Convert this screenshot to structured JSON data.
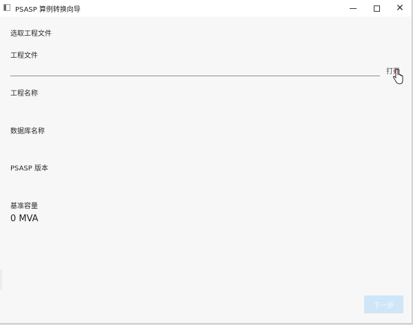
{
  "window": {
    "title": "PSASP 算例转换向导",
    "icon": "app-window-icon"
  },
  "titlebar_buttons": {
    "minimize": "minimize-icon",
    "maximize": "maximize-icon",
    "close_glyph": "✕"
  },
  "form": {
    "section_title": "选取工程文件",
    "project_file_label": "工程文件",
    "project_file_value": "",
    "open_button_label": "打开",
    "project_name_label": "工程名称",
    "database_name_label": "数据库名称",
    "psasp_version_label": "PSASP 版本",
    "base_capacity_label": "基准容量",
    "base_capacity_value": "0 MVA"
  },
  "footer": {
    "next_button_label": "下一步"
  },
  "colors": {
    "next_button_disabled_bg": "#cfe6f8",
    "background": "#f7f7f7"
  }
}
